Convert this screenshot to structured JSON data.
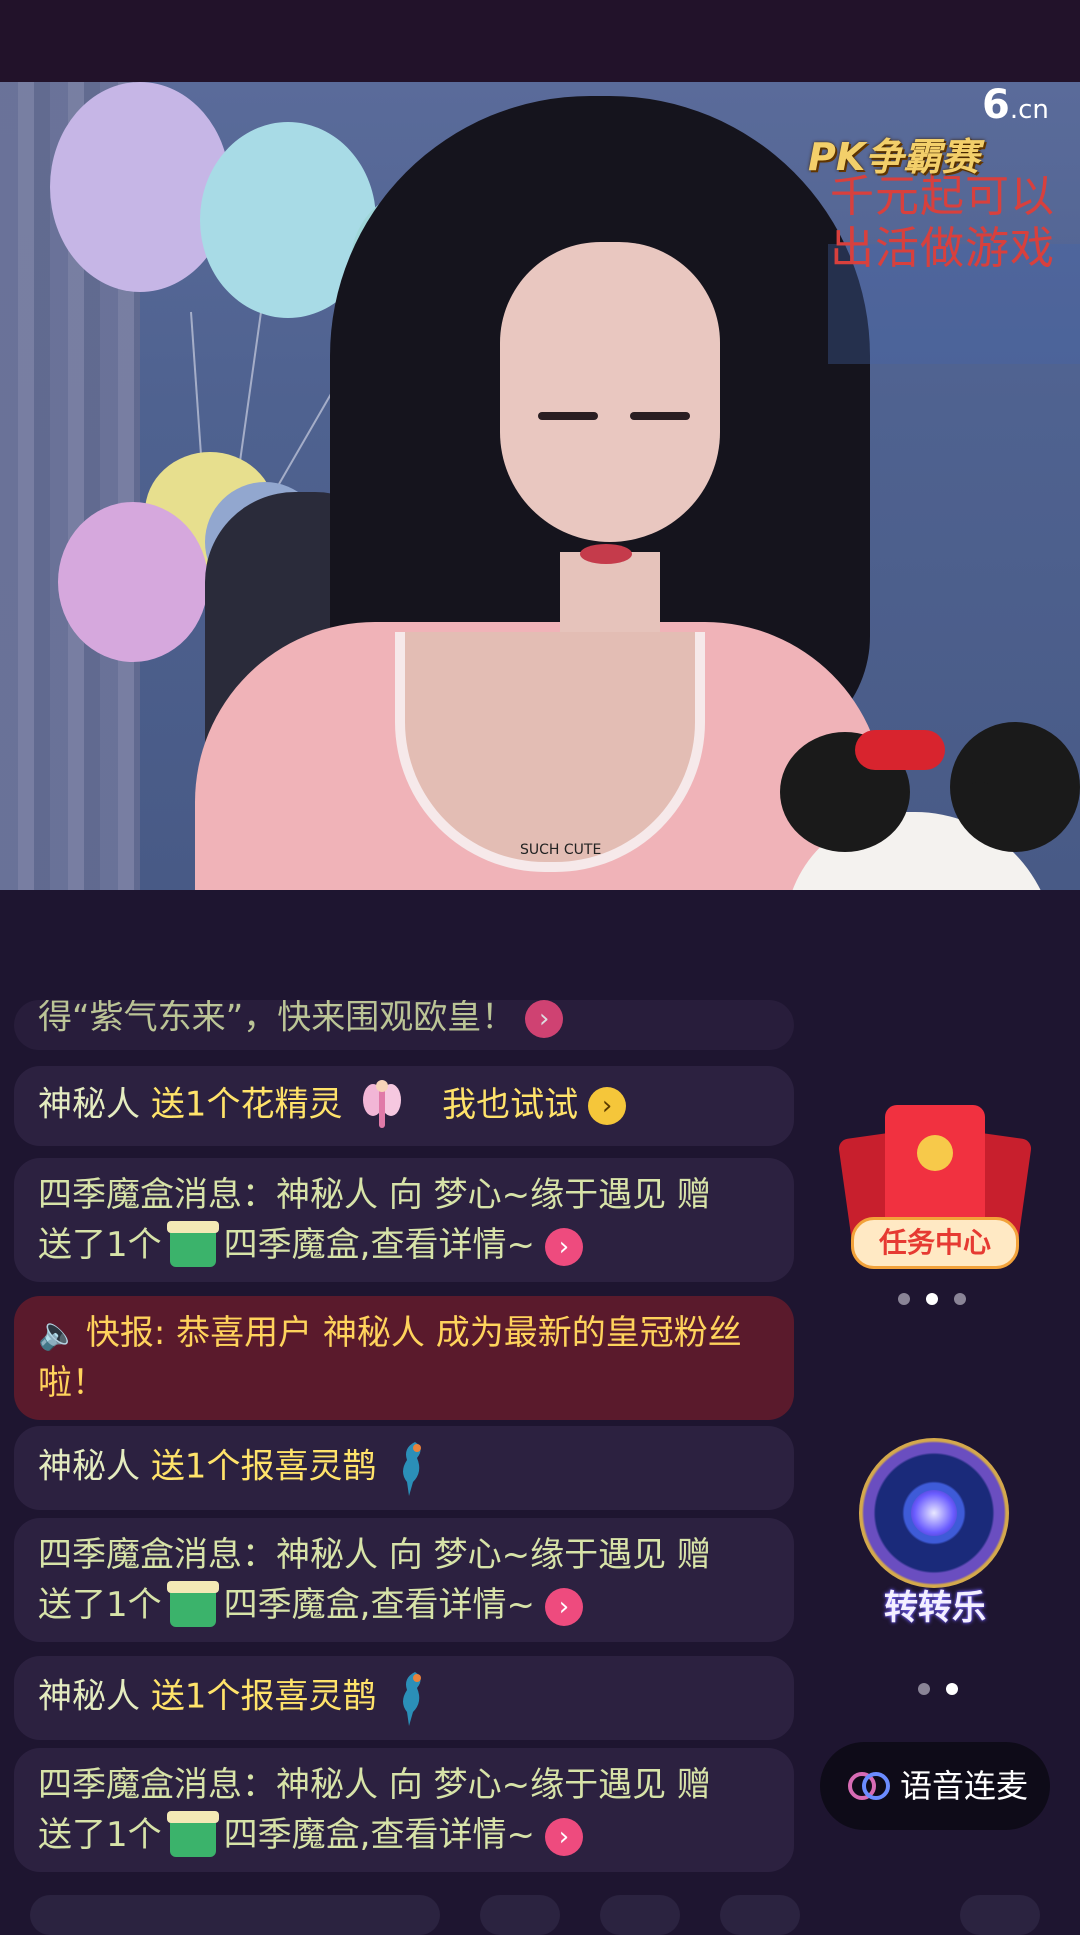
{
  "video": {
    "watermark_main": "6",
    "watermark_sub": ".cn",
    "pk_title": "PK争霸赛",
    "sign_lines": [
      "千元起可以",
      "出活做游戏"
    ],
    "shirt_text": "SUCH CUTE"
  },
  "chat": {
    "messages": [
      {
        "type": "system",
        "text": "得“紫气东来”，快来围观欧皇！"
      },
      {
        "type": "gift",
        "user": "神秘人",
        "action": "送1个花精灵",
        "gift_icon": "fairy-icon",
        "cta": "我也试试"
      },
      {
        "type": "box",
        "text1": "四季魔盒消息：神秘人 向 梦心~缘于遇见 赠",
        "text2a": "送了1个",
        "gift_icon": "gift-box-icon",
        "text2b": "四季魔盒,查看详情~"
      },
      {
        "type": "alert",
        "text": "快报: 恭喜用户 神秘人 成为最新的皇冠粉丝啦！"
      },
      {
        "type": "gift",
        "user": "神秘人",
        "action": "送1个报喜灵鹊",
        "gift_icon": "magpie-icon"
      },
      {
        "type": "box",
        "text1": "四季魔盒消息：神秘人 向 梦心~缘于遇见 赠",
        "text2a": "送了1个",
        "gift_icon": "gift-box-icon",
        "text2b": "四季魔盒,查看详情~"
      },
      {
        "type": "gift",
        "user": "神秘人",
        "action": "送1个报喜灵鹊",
        "gift_icon": "magpie-icon"
      },
      {
        "type": "box",
        "text1": "四季魔盒消息：神秘人 向 梦心~缘于遇见 赠",
        "text2a": "送了1个",
        "gift_icon": "gift-box-icon",
        "text2b": "四季魔盒,查看详情~"
      }
    ]
  },
  "side": {
    "task_center": "任务中心",
    "wheel_label": "转转乐",
    "voice_link": "语音连麦"
  },
  "colors": {
    "background": "#1e1530",
    "gift_text": "#ffe36a",
    "system_text": "#d7e3a8",
    "alert_bg": "#5a1a2c",
    "arrow_pink": "#ee4b7e"
  }
}
